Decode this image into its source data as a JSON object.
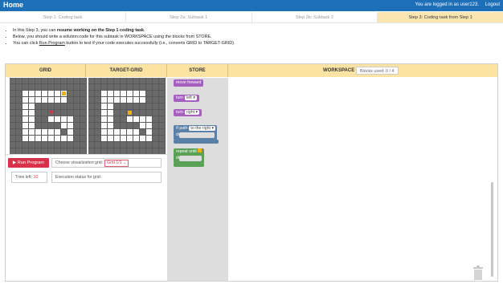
{
  "header": {
    "home": "Home",
    "user_text": "You are logged in as user123.",
    "logout": "Logout"
  },
  "steps": [
    "Step 1: Coding task",
    "Step 2a: Subtask 1",
    "Step 2b: Subtask 2",
    "Step 3: Coding task from Step 1"
  ],
  "instructions": {
    "line1_pre": "In this Step 3, you can ",
    "line1_bold": "resume working on the Step 1 coding task",
    "line1_post": ".",
    "line2": "Below, you should write a solution code for this subtask in WORKSPACE using the blocks from STORE.",
    "line3_pre": "You can click ",
    "line3_link": "Run Program",
    "line3_post": " button to test if your code executes successfully (i.e., converts GRID to TARGET-GRID)."
  },
  "columns": {
    "grid": "GRID",
    "target": "TARGET-GRID",
    "store": "STORE",
    "workspace": "WORKSPACE",
    "blocks_used": "Blocks used: 0 / 4"
  },
  "controls": {
    "run": "Run Program",
    "choose_label": "Choose visualization grid:",
    "choose_value": "Grid 1/1",
    "tries_label": "Tries left:",
    "tries_value": "10",
    "exec_status": "Execution status for grid:"
  },
  "store_blocks": {
    "move": "move forward",
    "turn": "turn",
    "left": "left",
    "right": "right",
    "if_path": "If path",
    "if_dir": "to the right",
    "do": "do",
    "repeat_until": "repeat until",
    "do2": "do"
  },
  "colors": {
    "header_blue": "#1d6fb8",
    "active_step": "#fbe6b2",
    "column_header": "#fbe3a4",
    "run_red": "#d8324a",
    "action_block": "#a55fbe",
    "if_block": "#5a80a8",
    "repeat_block": "#5aa055"
  },
  "icons": {
    "play": "play-icon",
    "goal": "goal-icon",
    "avatar": "avatar-icon",
    "trash": "trash-icon"
  }
}
